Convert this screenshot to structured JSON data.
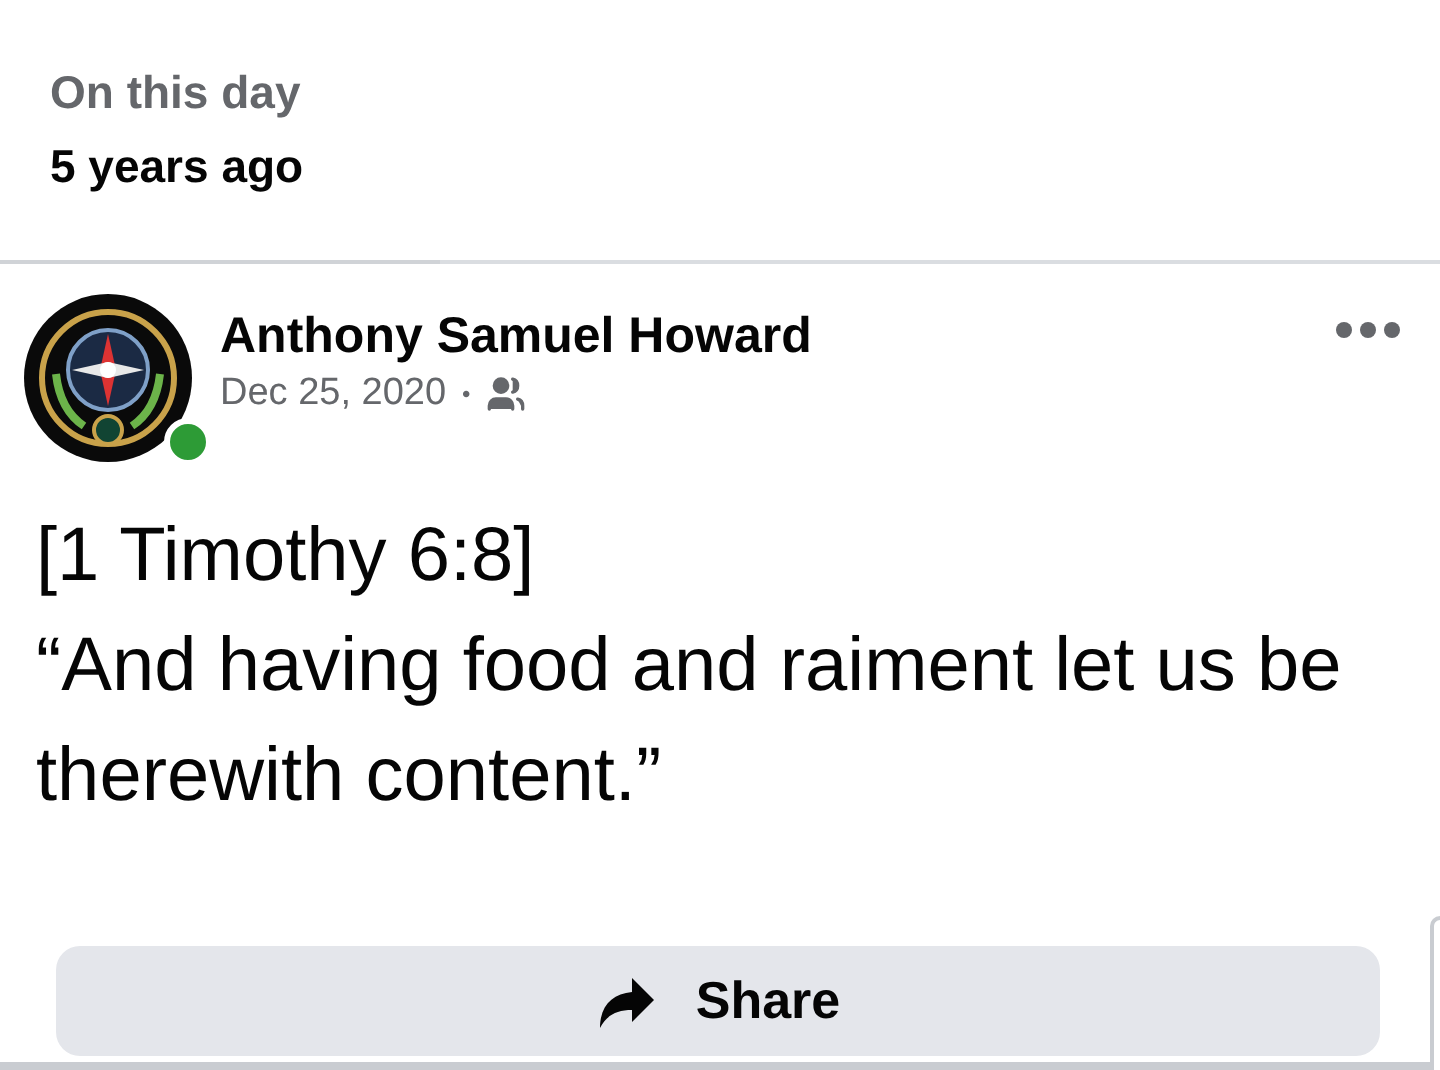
{
  "memory_header": {
    "title": "On this day",
    "subtitle": "5 years ago"
  },
  "post": {
    "author": "Anthony Samuel Howard",
    "online": true,
    "date": "Dec 25, 2020",
    "separator": "•",
    "lines": [
      "[1 Timothy 6:8]",
      "“And having food and raiment let us be therewith content.”"
    ]
  },
  "share_button": {
    "label": "Share"
  }
}
